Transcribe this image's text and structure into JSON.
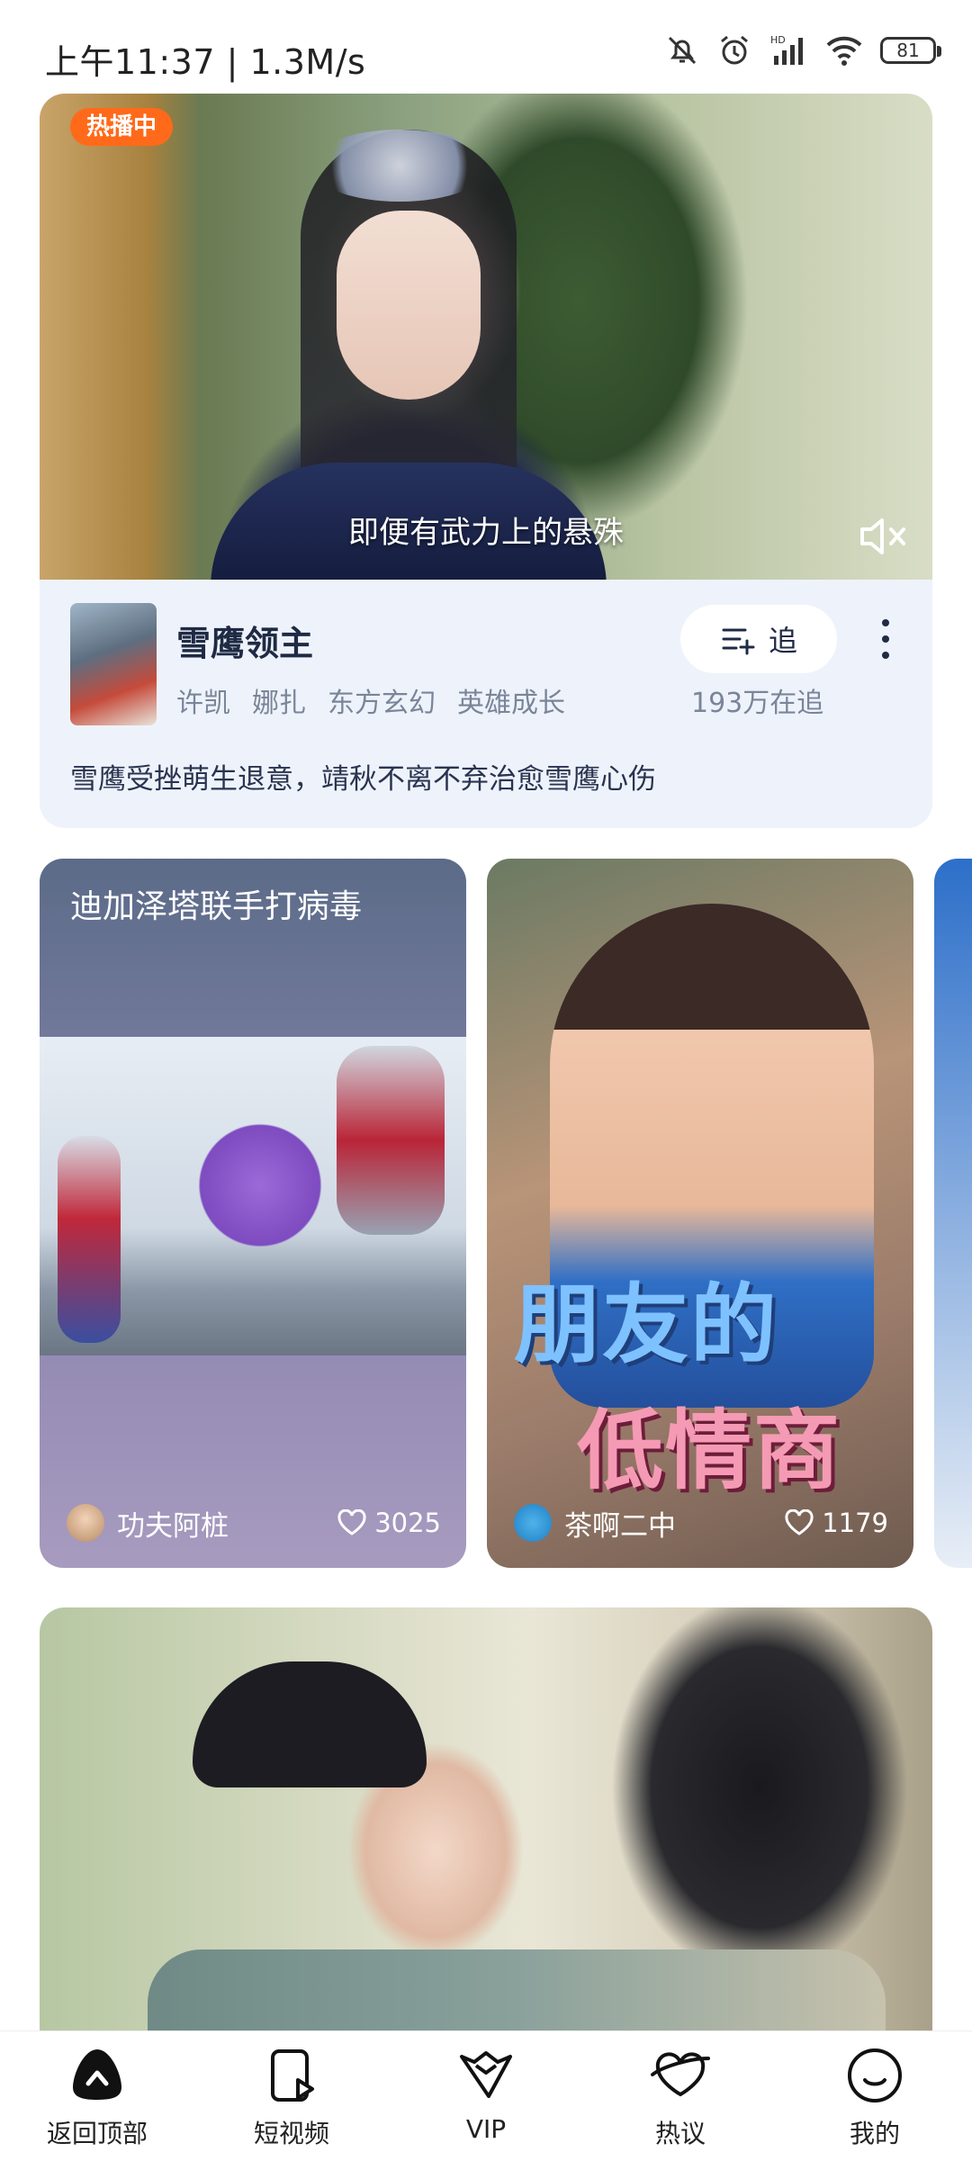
{
  "status_bar": {
    "time": "上午11:37 | 1.3M/s",
    "battery": "81"
  },
  "hero": {
    "badge": "热播中",
    "subtitle": "即便有武力上的悬殊",
    "title": "雪鹰领主",
    "tags": [
      "许凯",
      "娜扎",
      "东方玄幻",
      "英雄成长"
    ],
    "follow_label": "追",
    "follow_count": "193万在追",
    "description": "雪鹰受挫萌生退意，靖秋不离不弃治愈雪鹰心伤"
  },
  "short_videos": [
    {
      "title": "迪加泽塔联手打病毒",
      "author": "功夫阿桩",
      "likes": "3025"
    },
    {
      "title": "",
      "overlay_line1": "朋友的",
      "overlay_line2": "低情商",
      "author": "茶啊二中",
      "likes": "1179"
    }
  ],
  "nav": [
    {
      "label": "返回顶部",
      "icon": "back-to-top-icon"
    },
    {
      "label": "短视频",
      "icon": "short-video-icon"
    },
    {
      "label": "VIP",
      "icon": "vip-crown-icon"
    },
    {
      "label": "热议",
      "icon": "hot-discussion-icon"
    },
    {
      "label": "我的",
      "icon": "profile-icon"
    }
  ],
  "colors": {
    "accent_badge": "#ff6a1a",
    "info_bg": "#eef3fb",
    "title_text": "#1f2a44",
    "muted_text": "#7a8599"
  }
}
